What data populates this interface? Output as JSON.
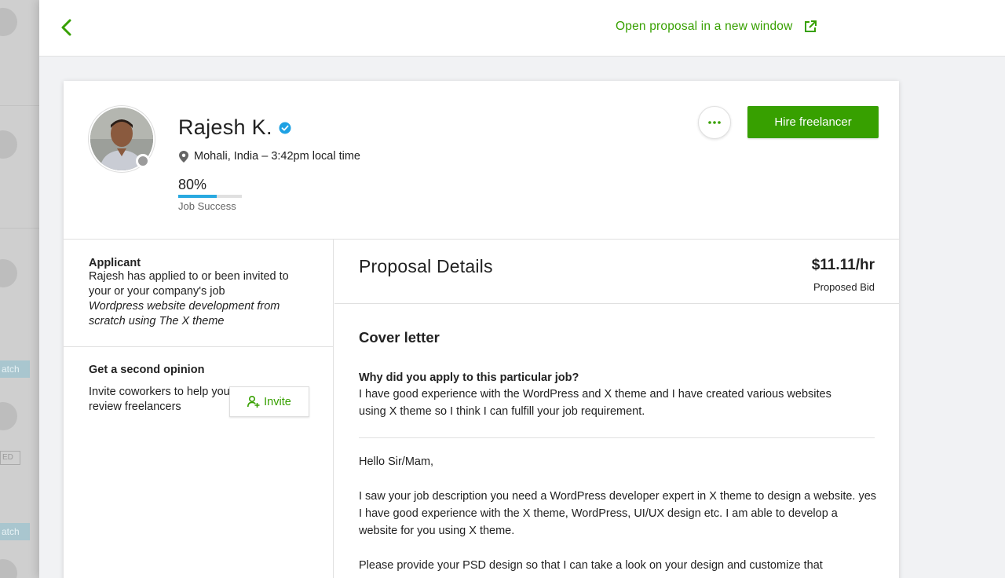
{
  "background": {
    "chip_1": "atch",
    "chip_2": "atch",
    "tag": "ED"
  },
  "panel_header": {
    "open_link_label": "Open proposal in a new window"
  },
  "profile": {
    "name": "Rajesh K.",
    "location": "Mohali, India – 3:42pm local time",
    "job_success_value": "80%",
    "job_success_fraction": 0.6,
    "job_success_label": "Job Success",
    "hire_button": "Hire freelancer"
  },
  "sidebar": {
    "applicant_title": "Applicant",
    "applicant_text": "Rajesh has applied to or been invited to your or your company's job",
    "applicant_job": "Wordpress website development from scratch using The X theme",
    "second_opinion_title": "Get a second opinion",
    "second_opinion_text": "Invite coworkers to help you review freelancers",
    "invite_button": "Invite"
  },
  "proposal": {
    "title": "Proposal Details",
    "bid": "$11.11/hr",
    "bid_label": "Proposed Bid",
    "cover_title": "Cover letter",
    "question": "Why did you apply to this particular job?",
    "answer": "I have good experience with the WordPress and X theme and I have created various websites using X theme so I think I can fulfill your job requirement.",
    "letter": [
      "Hello Sir/Mam,",
      "I saw your job description you need a WordPress developer expert in X theme to design a website. yes I have good experience with the X theme, WordPress, UI/UX design etc. I am able to develop a website for you using X theme.",
      "Please provide your PSD design so that I can take a look on your design and customize that"
    ]
  },
  "colors": {
    "accent_green": "#37a000",
    "job_success_blue": "#29a9e0",
    "verified_blue": "#1ea1e3"
  },
  "icons": [
    "chevron-left-icon",
    "external-link-icon",
    "verified-badge-icon",
    "map-pin-icon",
    "more-dots-icon",
    "add-user-icon"
  ]
}
